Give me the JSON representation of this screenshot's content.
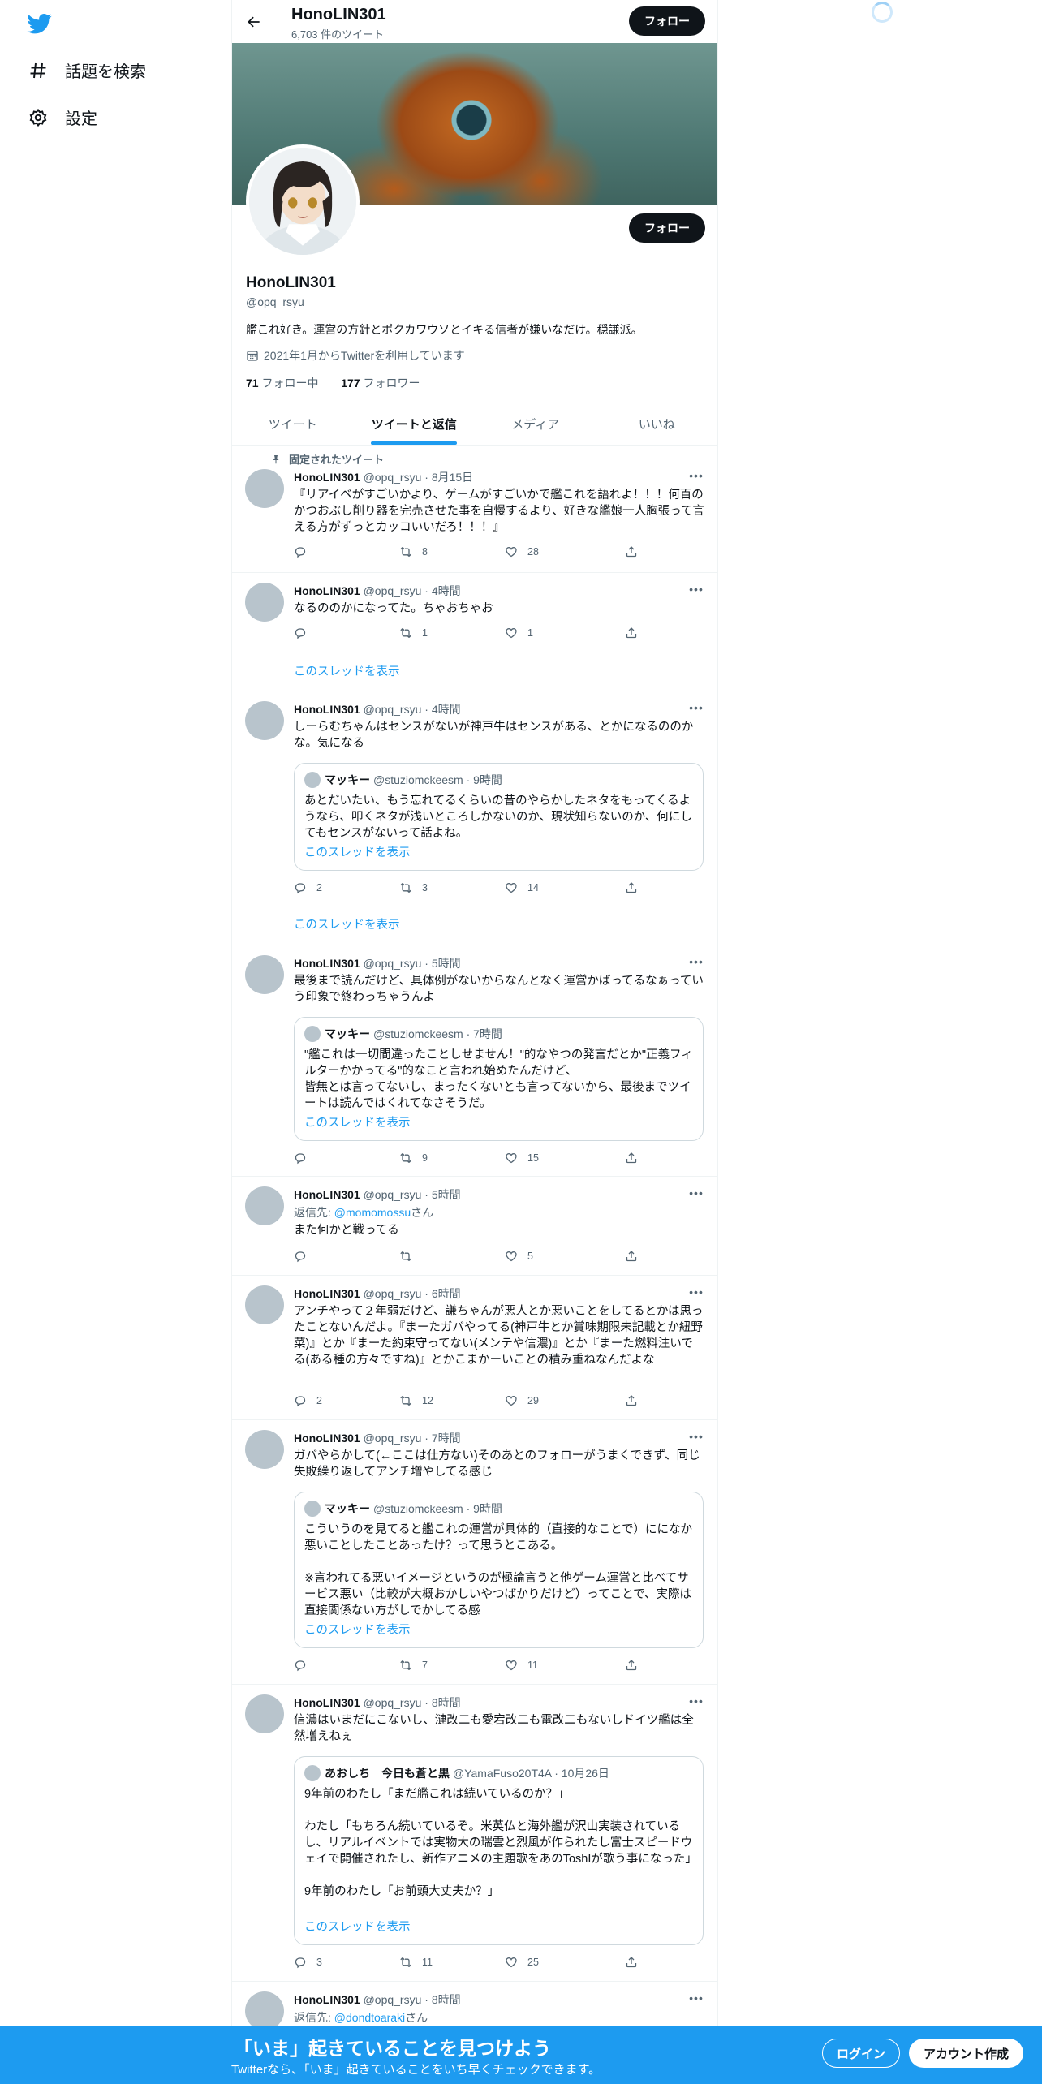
{
  "colors": {
    "accent": "#1d9bf0",
    "text": "#0f1419",
    "muted": "#536471"
  },
  "nav": {
    "logo_icon": "twitter-bird-icon",
    "explore": "話題を検索",
    "settings": "設定"
  },
  "topbar": {
    "name": "HonoLIN301",
    "tweet_count": "6,703 件のツイート",
    "follow": "フォロー"
  },
  "profile": {
    "name": "HonoLIN301",
    "handle": "@opq_rsyu",
    "bio": "艦これ好き。運営の方針とポクカワウソとイキる信者が嫌いなだけ。穏謙派。",
    "joined": "2021年1月からTwitterを利用しています",
    "following_count": "71",
    "following_label": "フォロー中",
    "followers_count": "177",
    "followers_label": "フォロワー",
    "follow": "フォロー"
  },
  "tabs": [
    "ツイート",
    "ツイートと返信",
    "メディア",
    "いいね"
  ],
  "tweets": [
    {
      "pinned": "固定されたツイート",
      "name": "HonoLIN301",
      "meta": "@opq_rsyu · 8月15日",
      "text": "『リアイベがすごいかより、ゲームがすごいかで艦これを語れよ！！！何百のかつおぶし削り器を完売させた事を自慢するより、好きな艦娘一人胸張って言える方がずっとカッコいいだろ！！！』",
      "retweets": "8",
      "likes": "28"
    },
    {
      "name": "HonoLIN301",
      "meta": "@opq_rsyu · 4時間",
      "text": "なるののかになってた。ちゃおちゃお",
      "retweets": "1",
      "likes": "1",
      "thread": "このスレッドを表示"
    },
    {
      "name": "HonoLIN301",
      "meta": "@opq_rsyu · 4時間",
      "text": "しーらむちゃんはセンスがないが神戸牛はセンスがある、とかになるののかな。気になる",
      "quote": {
        "name": "マッキー",
        "meta": "@stuziomckeesm · 9時間",
        "text": "あとだいたい、もう忘れてるくらいの昔のやらかしたネタをもってくるようなら、叩くネタが浅いところしかないのか、現状知らないのか、何にしてもセンスがないって話よね。",
        "link": "このスレッドを表示"
      },
      "replies": "2",
      "retweets": "3",
      "likes": "14",
      "thread": "このスレッドを表示"
    },
    {
      "name": "HonoLIN301",
      "meta": "@opq_rsyu · 5時間",
      "text": "最後まで読んだけど、具体例がないからなんとなく運営かばってるなぁっていう印象で終わっちゃうんよ",
      "quote": {
        "name": "マッキー",
        "meta": "@stuziomckeesm · 7時間",
        "text": "\"艦これは一切間違ったことしせません！\"的なやつの発言だとか\"正義フィルターかかってる\"的なこと言われ始めたんだけど、\n皆無とは言ってないし、まったくないとも言ってないから、最後までツイートは読んではくれてなさそうだ。",
        "link": "このスレッドを表示"
      },
      "retweets": "9",
      "likes": "15"
    },
    {
      "name": "HonoLIN301",
      "meta": "@opq_rsyu · 5時間",
      "reply_prefix": "返信先: ",
      "reply_to": "@momomossu",
      "reply_suffix": "さん",
      "text": "また何かと戦ってる",
      "likes": "5"
    },
    {
      "name": "HonoLIN301",
      "meta": "@opq_rsyu · 6時間",
      "text": "アンチやって２年弱だけど、謙ちゃんが悪人とか悪いことをしてるとかは思ったことないんだよ。『まーたガバやってる(神戸牛とか賞味期限未記載とか紐野菜)』とか『まーた約束守ってない(メンテや信濃)』とか『まーた燃料注いでる(ある種の方々ですね)』とかこまかーいことの積み重ねなんだよな",
      "replies": "2",
      "retweets": "12",
      "likes": "29"
    },
    {
      "name": "HonoLIN301",
      "meta": "@opq_rsyu · 7時間",
      "text": "ガバやらかして(←ここは仕方ない)そのあとのフォローがうまくできず、同じ失敗繰り返してアンチ増やしてる感じ",
      "quote": {
        "name": "マッキー",
        "meta": "@stuziomckeesm · 9時間",
        "text": "こういうのを見てると艦これの運営が具体的（直接的なことで）にになか悪いことしたことあったけ？って思うとこある。\n\n※言われてる悪いイメージというのが極論言うと他ゲーム運営と比べてサービス悪い（比較が大概おかしいやつばかりだけど）ってことで、実際は直接関係ない方がしでかしてる感",
        "link": "このスレッドを表示"
      },
      "retweets": "7",
      "likes": "11"
    },
    {
      "name": "HonoLIN301",
      "meta": "@opq_rsyu · 8時間",
      "text": "信濃はいまだにこないし、漣改二も愛宕改二も電改二もないしドイツ艦は全然増えねぇ",
      "quote": {
        "name": "あおしち　今日も蒼と黒",
        "meta": "@YamaFuso20T4A · 10月26日",
        "text": "9年前のわたし「まだ艦これは続いているのか？」\n\nわたし「もちろん続いているぞ。米英仏と海外艦が沢山実装されているし、リアルイベントでは実物大の瑞雲と烈風が作られたし富士スピードウェイで開催されたし、新作アニメの主題歌をあのToshIが歌う事になった」\n\n9年前のわたし「お前頭大丈夫か？」",
        "link": "このスレッドを表示"
      },
      "replies": "3",
      "retweets": "11",
      "likes": "25"
    },
    {
      "name": "HonoLIN301",
      "meta": "@opq_rsyu · 8時間",
      "reply_prefix": "返信先: ",
      "reply_to": "@dondtoaraki",
      "reply_suffix": "さん"
    }
  ],
  "bottom": {
    "title": "「いま」起きていることを見つけよう",
    "subtitle": "Twitterなら、「いま」起きていることをいち早くチェックできます。",
    "login": "ログイン",
    "signup": "アカウント作成"
  }
}
